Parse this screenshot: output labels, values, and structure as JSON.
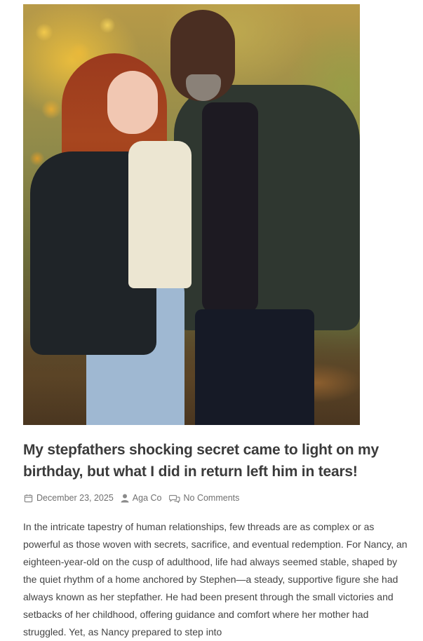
{
  "article": {
    "image_alt": "Young red-haired woman and older man posing in an autumn forest",
    "title": "My stepfathers shocking secret came to light on my birthday, but what I did in return left him in tears!",
    "meta": {
      "date": "December 23, 2025",
      "author": "Aga Co",
      "comments": "No Comments",
      "date_icon": "calendar-icon",
      "author_icon": "user-icon",
      "comments_icon": "comments-icon"
    },
    "body": "In the intricate tapestry of human relationships, few threads are as complex or as powerful as those woven with secrets, sacrifice, and eventual redemption. For Nancy, an eighteen-year-old on the cusp of adulthood, life had always seemed stable, shaped by the quiet rhythm of a home anchored by Stephen—a steady, supportive figure she had always known as her stepfather. He had been present through the small victories and setbacks of her childhood, offering guidance and comfort where her mother had struggled. Yet, as Nancy prepared to step into"
  },
  "colors": {
    "title": "#3b3b3b",
    "meta": "#707070",
    "body": "#444444"
  }
}
